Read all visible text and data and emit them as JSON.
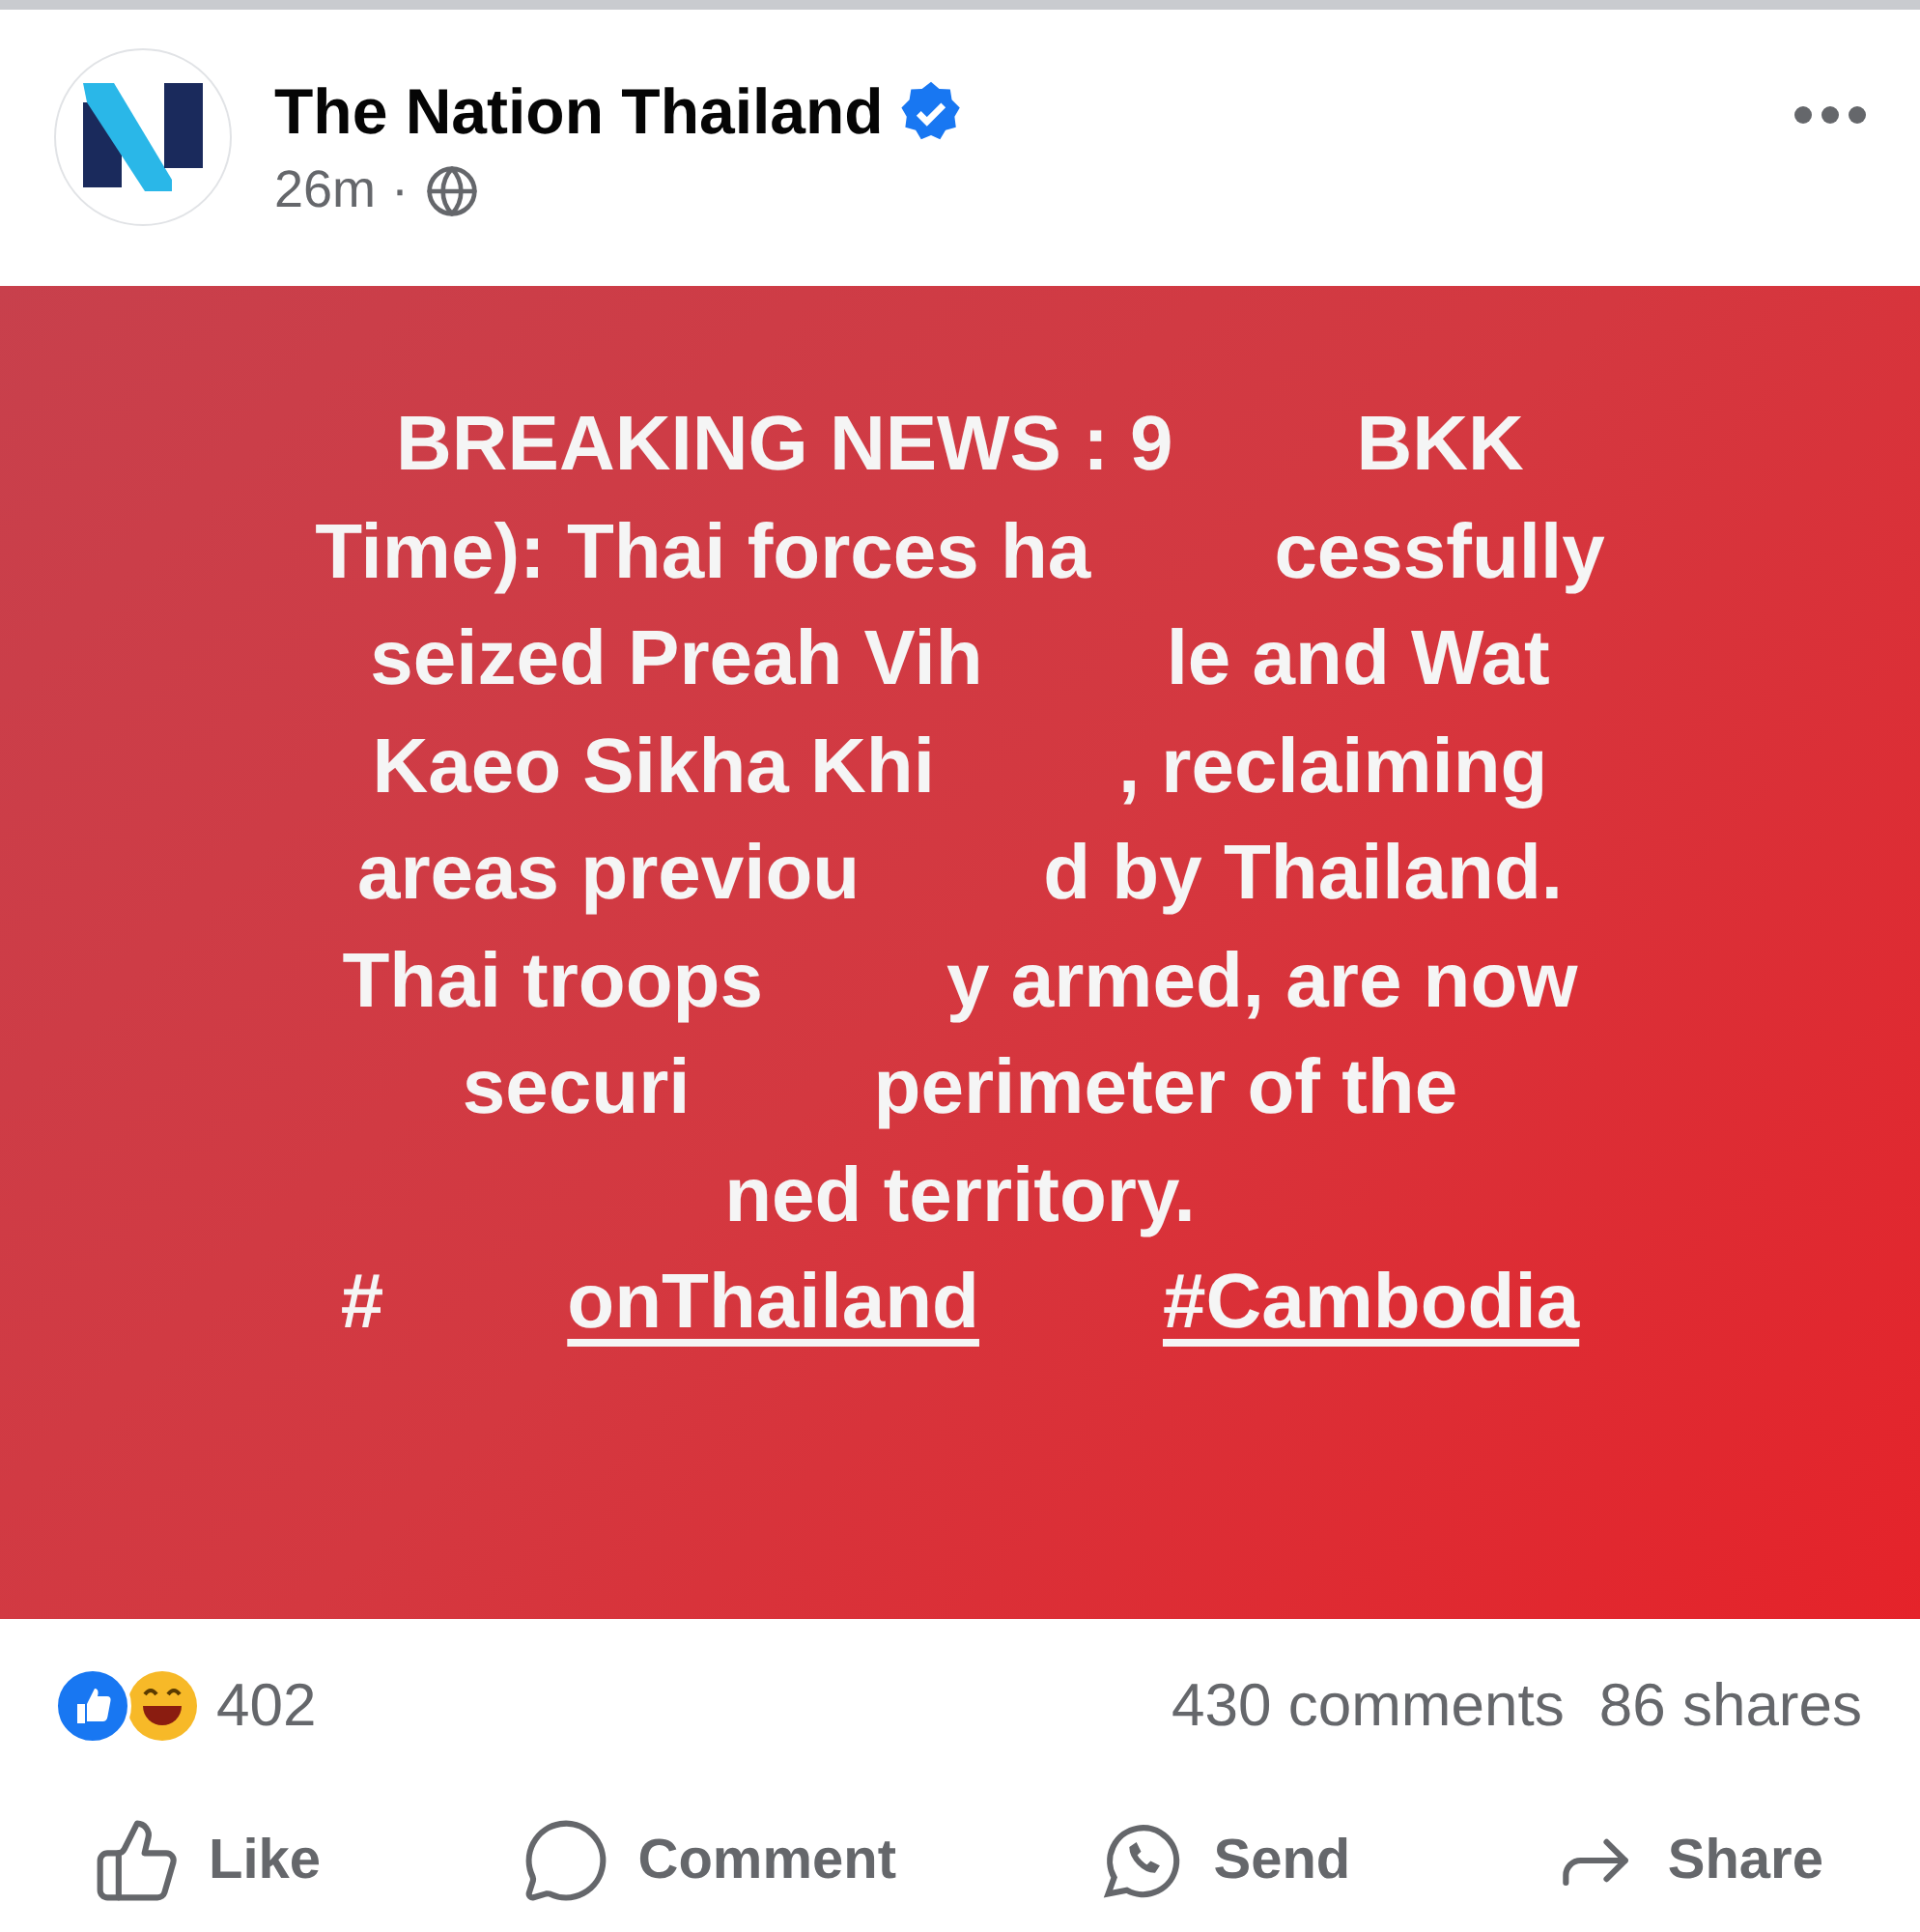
{
  "post": {
    "author": "The Nation Thailand",
    "verified": true,
    "time": "26m",
    "separator": "·"
  },
  "card": {
    "lines": [
      {
        "parts": [
          {
            "text": "BREAKING NEWS : 9"
          },
          {
            "text": "BKK"
          }
        ]
      },
      {
        "parts": [
          {
            "text": "Time): Thai forces ha"
          },
          {
            "text": "cessfully"
          }
        ]
      },
      {
        "parts": [
          {
            "text": "seized Preah Vih"
          },
          {
            "text": "le and Wat"
          }
        ]
      },
      {
        "parts": [
          {
            "text": "Kaeo Sikha Khi"
          },
          {
            "text": ", reclaiming"
          }
        ]
      },
      {
        "parts": [
          {
            "text": "areas previou"
          },
          {
            "text": "d by Thailand."
          }
        ]
      },
      {
        "parts": [
          {
            "text": "Thai troops"
          },
          {
            "text": "y armed, are now"
          }
        ]
      },
      {
        "parts": [
          {
            "text": "securi"
          },
          {
            "text": "perimeter of the"
          }
        ]
      },
      {
        "parts": [
          {
            "text": "ned territory."
          }
        ]
      },
      {
        "parts": [
          {
            "text": "#",
            "kind": "plain"
          },
          {
            "text": "onThailand",
            "kind": "hashtag"
          },
          {
            "text": "#Cambodia",
            "kind": "hashtag"
          }
        ]
      }
    ]
  },
  "stats": {
    "reactions": "402",
    "comments": "430 comments",
    "shares": "86 shares"
  },
  "actions": [
    {
      "label": "Like",
      "kind": "like"
    },
    {
      "label": "Comment",
      "kind": "comment"
    },
    {
      "label": "Send",
      "kind": "send"
    },
    {
      "label": "Share",
      "kind": "share"
    }
  ]
}
